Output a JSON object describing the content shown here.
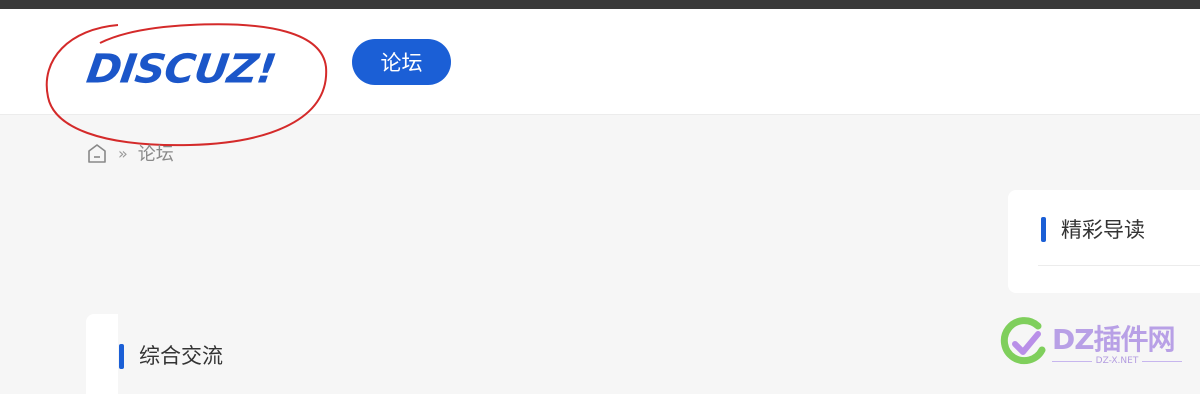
{
  "header": {
    "logo_text": "DISCUZ!",
    "nav": {
      "forum_label": "论坛"
    }
  },
  "breadcrumb": {
    "home_icon": "home-icon",
    "separator": "»",
    "current": "论坛"
  },
  "sidebar_card": {
    "title": "精彩导读"
  },
  "main_section": {
    "title": "综合交流"
  },
  "watermark": {
    "logo_text": "DZ插件网",
    "subtext": "DZ-X.NET"
  },
  "colors": {
    "brand_blue": "#1b5fd6",
    "logo_blue": "#1b56c9",
    "annotation_red": "#d42a2a",
    "page_bg": "#f6f6f6",
    "topbar": "#3a3a3a"
  }
}
